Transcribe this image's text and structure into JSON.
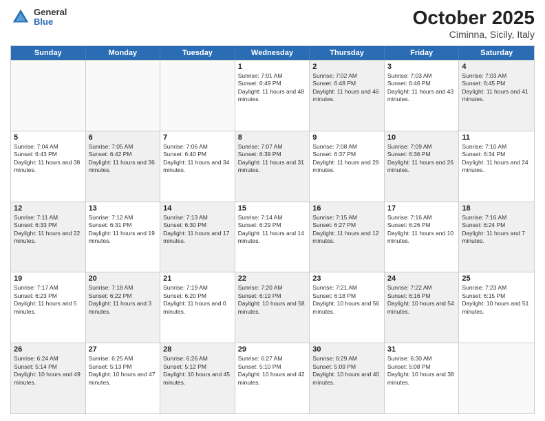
{
  "header": {
    "logo_line1": "General",
    "logo_line2": "Blue",
    "title": "October 2025",
    "subtitle": "Ciminna, Sicily, Italy"
  },
  "days_of_week": [
    "Sunday",
    "Monday",
    "Tuesday",
    "Wednesday",
    "Thursday",
    "Friday",
    "Saturday"
  ],
  "weeks": [
    [
      {
        "day": "",
        "text": "",
        "empty": true
      },
      {
        "day": "",
        "text": "",
        "empty": true
      },
      {
        "day": "",
        "text": "",
        "empty": true
      },
      {
        "day": "1",
        "text": "Sunrise: 7:01 AM\nSunset: 6:49 PM\nDaylight: 11 hours and 48 minutes."
      },
      {
        "day": "2",
        "text": "Sunrise: 7:02 AM\nSunset: 6:48 PM\nDaylight: 11 hours and 46 minutes."
      },
      {
        "day": "3",
        "text": "Sunrise: 7:03 AM\nSunset: 6:46 PM\nDaylight: 11 hours and 43 minutes."
      },
      {
        "day": "4",
        "text": "Sunrise: 7:03 AM\nSunset: 6:45 PM\nDaylight: 11 hours and 41 minutes."
      }
    ],
    [
      {
        "day": "5",
        "text": "Sunrise: 7:04 AM\nSunset: 6:43 PM\nDaylight: 11 hours and 38 minutes."
      },
      {
        "day": "6",
        "text": "Sunrise: 7:05 AM\nSunset: 6:42 PM\nDaylight: 11 hours and 36 minutes."
      },
      {
        "day": "7",
        "text": "Sunrise: 7:06 AM\nSunset: 6:40 PM\nDaylight: 11 hours and 34 minutes."
      },
      {
        "day": "8",
        "text": "Sunrise: 7:07 AM\nSunset: 6:39 PM\nDaylight: 11 hours and 31 minutes."
      },
      {
        "day": "9",
        "text": "Sunrise: 7:08 AM\nSunset: 6:37 PM\nDaylight: 11 hours and 29 minutes."
      },
      {
        "day": "10",
        "text": "Sunrise: 7:09 AM\nSunset: 6:36 PM\nDaylight: 11 hours and 26 minutes."
      },
      {
        "day": "11",
        "text": "Sunrise: 7:10 AM\nSunset: 6:34 PM\nDaylight: 11 hours and 24 minutes."
      }
    ],
    [
      {
        "day": "12",
        "text": "Sunrise: 7:11 AM\nSunset: 6:33 PM\nDaylight: 11 hours and 22 minutes."
      },
      {
        "day": "13",
        "text": "Sunrise: 7:12 AM\nSunset: 6:31 PM\nDaylight: 11 hours and 19 minutes."
      },
      {
        "day": "14",
        "text": "Sunrise: 7:13 AM\nSunset: 6:30 PM\nDaylight: 11 hours and 17 minutes."
      },
      {
        "day": "15",
        "text": "Sunrise: 7:14 AM\nSunset: 6:29 PM\nDaylight: 11 hours and 14 minutes."
      },
      {
        "day": "16",
        "text": "Sunrise: 7:15 AM\nSunset: 6:27 PM\nDaylight: 11 hours and 12 minutes."
      },
      {
        "day": "17",
        "text": "Sunrise: 7:16 AM\nSunset: 6:26 PM\nDaylight: 11 hours and 10 minutes."
      },
      {
        "day": "18",
        "text": "Sunrise: 7:16 AM\nSunset: 6:24 PM\nDaylight: 11 hours and 7 minutes."
      }
    ],
    [
      {
        "day": "19",
        "text": "Sunrise: 7:17 AM\nSunset: 6:23 PM\nDaylight: 11 hours and 5 minutes."
      },
      {
        "day": "20",
        "text": "Sunrise: 7:18 AM\nSunset: 6:22 PM\nDaylight: 11 hours and 3 minutes."
      },
      {
        "day": "21",
        "text": "Sunrise: 7:19 AM\nSunset: 6:20 PM\nDaylight: 11 hours and 0 minutes."
      },
      {
        "day": "22",
        "text": "Sunrise: 7:20 AM\nSunset: 6:19 PM\nDaylight: 10 hours and 58 minutes."
      },
      {
        "day": "23",
        "text": "Sunrise: 7:21 AM\nSunset: 6:18 PM\nDaylight: 10 hours and 56 minutes."
      },
      {
        "day": "24",
        "text": "Sunrise: 7:22 AM\nSunset: 6:16 PM\nDaylight: 10 hours and 54 minutes."
      },
      {
        "day": "25",
        "text": "Sunrise: 7:23 AM\nSunset: 6:15 PM\nDaylight: 10 hours and 51 minutes."
      }
    ],
    [
      {
        "day": "26",
        "text": "Sunrise: 6:24 AM\nSunset: 5:14 PM\nDaylight: 10 hours and 49 minutes."
      },
      {
        "day": "27",
        "text": "Sunrise: 6:25 AM\nSunset: 5:13 PM\nDaylight: 10 hours and 47 minutes."
      },
      {
        "day": "28",
        "text": "Sunrise: 6:26 AM\nSunset: 5:12 PM\nDaylight: 10 hours and 45 minutes."
      },
      {
        "day": "29",
        "text": "Sunrise: 6:27 AM\nSunset: 5:10 PM\nDaylight: 10 hours and 42 minutes."
      },
      {
        "day": "30",
        "text": "Sunrise: 6:29 AM\nSunset: 5:09 PM\nDaylight: 10 hours and 40 minutes."
      },
      {
        "day": "31",
        "text": "Sunrise: 6:30 AM\nSunset: 5:08 PM\nDaylight: 10 hours and 38 minutes."
      },
      {
        "day": "",
        "text": "",
        "empty": true
      }
    ]
  ]
}
